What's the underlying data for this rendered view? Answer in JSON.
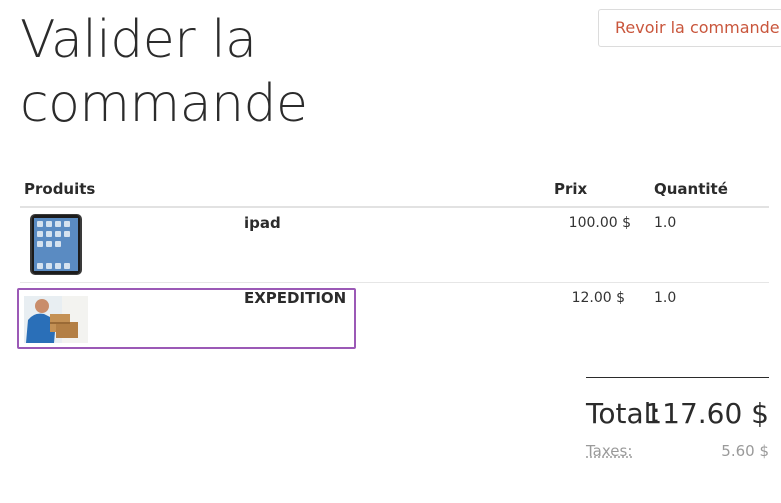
{
  "page": {
    "title": "Valider la commande"
  },
  "actions": {
    "review_label": "Revoir la commande"
  },
  "table": {
    "headers": {
      "products": "Produits",
      "price": "Prix",
      "quantity": "Quantité"
    },
    "rows": [
      {
        "name": "ipad",
        "price": "100.00 $",
        "quantity": "1.0",
        "image": "tablet-image"
      },
      {
        "name": "EXPEDITION",
        "price": "12.00 $",
        "quantity": "1.0",
        "image": "delivery-person-image"
      }
    ]
  },
  "summary": {
    "total_label": "Total:",
    "total_value": "117.60 $",
    "taxes_label": "Taxes:",
    "taxes_value": "5.60 $"
  },
  "colors": {
    "accent": "#c9563c",
    "highlight": "#9b59b6",
    "text": "#2b2b2b",
    "muted": "#9a9a9a"
  }
}
